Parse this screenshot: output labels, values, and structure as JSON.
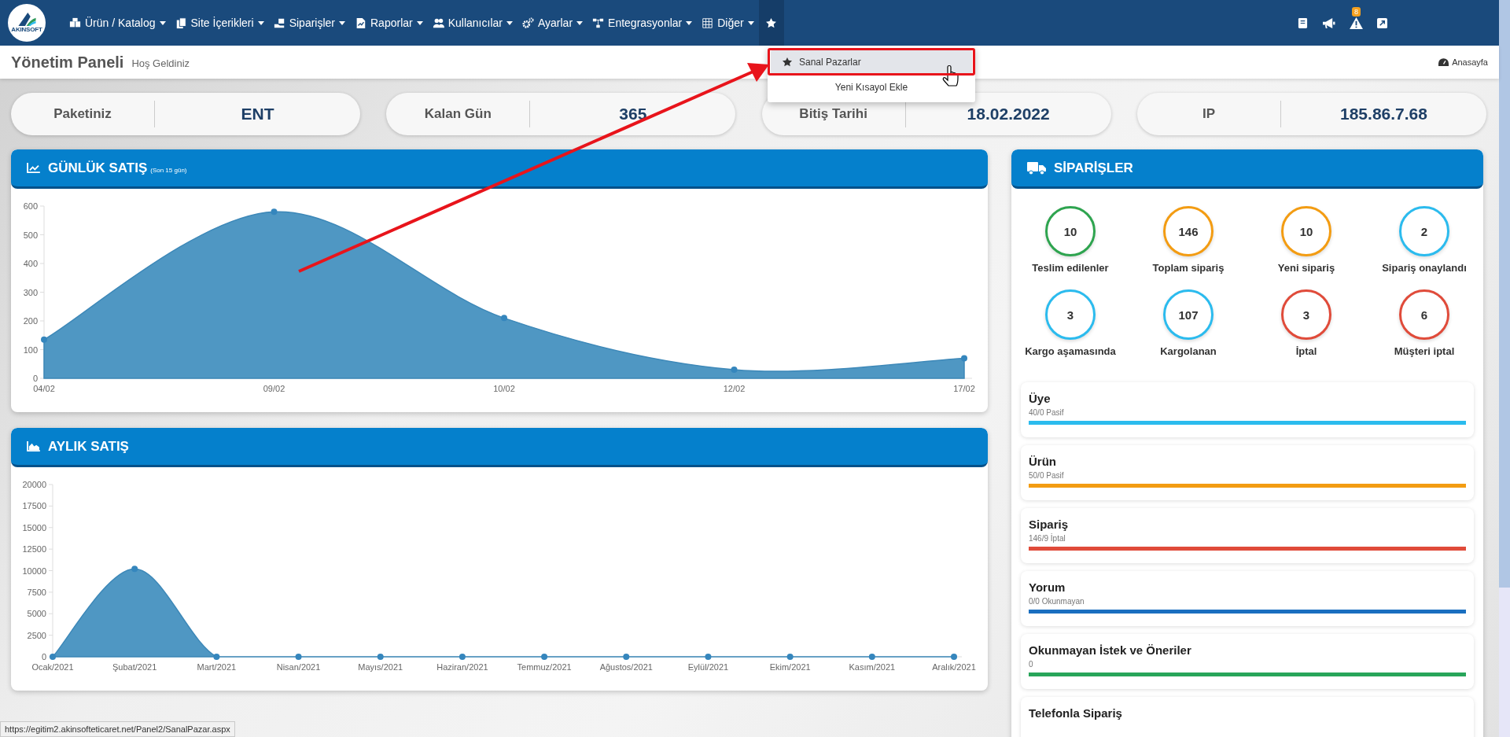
{
  "nav": {
    "logo_text": "AKINSOFT",
    "items": [
      {
        "label": "Ürün / Katalog"
      },
      {
        "label": "Site İçerikleri"
      },
      {
        "label": "Siparişler"
      },
      {
        "label": "Raporlar"
      },
      {
        "label": "Kullanıcılar"
      },
      {
        "label": "Ayarlar"
      },
      {
        "label": "Entegrasyonlar"
      },
      {
        "label": "Diğer"
      }
    ],
    "shortcuts": {
      "expanded": true,
      "items": [
        {
          "kind": "shortcut",
          "label": "Sanal Pazarlar",
          "selected": true
        },
        {
          "kind": "action",
          "label": "Yeni Kısayol Ekle",
          "selected": false
        }
      ]
    },
    "alert_badge": "8"
  },
  "page_header": {
    "title": "Yönetim Paneli",
    "subtitle": "Hoş Geldiniz",
    "home_link": "Anasayfa"
  },
  "info_cards": [
    {
      "label": "Paketiniz",
      "value": "ENT"
    },
    {
      "label": "Kalan Gün",
      "value": "365"
    },
    {
      "label": "Bitiş Tarihi",
      "value": "18.02.2022"
    },
    {
      "label": "IP",
      "value": "185.86.7.68"
    }
  ],
  "daily_sales": {
    "title": "GÜNLÜK SATIŞ",
    "subtitle": "(Son 15 gün)",
    "chart_data": {
      "type": "area",
      "categories": [
        "04/02",
        "09/02",
        "10/02",
        "12/02",
        "17/02"
      ],
      "values": [
        135,
        580,
        210,
        30,
        70
      ],
      "ylim": [
        0,
        600
      ],
      "yticks": [
        0,
        100,
        200,
        300,
        400,
        500,
        600
      ]
    }
  },
  "monthly_sales": {
    "title": "AYLIK SATIŞ",
    "chart_data": {
      "type": "area",
      "categories": [
        "Ocak/2021",
        "Şubat/2021",
        "Mart/2021",
        "Nisan/2021",
        "Mayıs/2021",
        "Haziran/2021",
        "Temmuz/2021",
        "Ağustos/2021",
        "Eylül/2021",
        "Ekim/2021",
        "Kasım/2021",
        "Aralık/2021"
      ],
      "values": [
        0,
        10200,
        0,
        0,
        0,
        0,
        0,
        0,
        0,
        0,
        0,
        0
      ],
      "ylim": [
        0,
        20000
      ],
      "yticks": [
        0,
        2500,
        5000,
        7500,
        10000,
        12500,
        15000,
        17500,
        20000
      ]
    }
  },
  "orders": {
    "title": "SİPARİŞLER",
    "stats": [
      {
        "value": "10",
        "label": "Teslim edilenler",
        "color": "#2ea44f"
      },
      {
        "value": "146",
        "label": "Toplam sipariş",
        "color": "#f39c12"
      },
      {
        "value": "10",
        "label": "Yeni sipariş",
        "color": "#f39c12"
      },
      {
        "value": "2",
        "label": "Sipariş onaylandı",
        "color": "#2bbbee"
      },
      {
        "value": "3",
        "label": "Kargo aşamasında",
        "color": "#2bbbee"
      },
      {
        "value": "107",
        "label": "Kargolanan",
        "color": "#2bbbee"
      },
      {
        "value": "3",
        "label": "İptal",
        "color": "#e04b3a"
      },
      {
        "value": "6",
        "label": "Müşteri iptal",
        "color": "#e04b3a"
      }
    ],
    "summaries": [
      {
        "title": "Üye",
        "detail": "40/0 Pasif",
        "color": "#2bbbee",
        "level": 1
      },
      {
        "title": "Ürün",
        "detail": "50/0 Pasif",
        "color": "#f39c12",
        "level": 1
      },
      {
        "title": "Sipariş",
        "detail": "146/9 İptal",
        "color": "#e04b3a",
        "level": 1
      },
      {
        "title": "Yorum",
        "detail": "0/0 Okunmayan",
        "color": "#1a6fc0",
        "level": 1
      },
      {
        "title": "Okunmayan İstek ve Öneriler",
        "detail": "0",
        "color": "#28a55a",
        "level": 1
      },
      {
        "title": "Telefonla Sipariş"
      }
    ]
  },
  "status_url": "https://egitim2.akinsofteticaret.net/Panel2/SanalPazar.aspx"
}
